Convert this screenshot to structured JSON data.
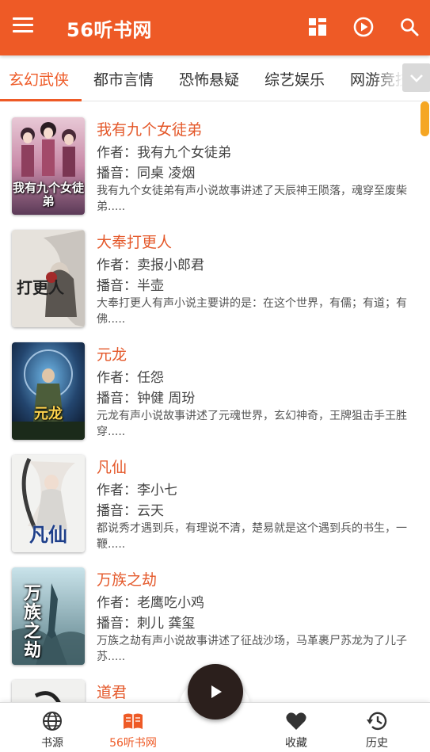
{
  "app": {
    "title": "56听书网"
  },
  "topbar": {
    "menu_icon": "menu-icon",
    "grid_icon": "grid-icon",
    "play_icon": "play-circle-icon",
    "search_icon": "search-icon"
  },
  "tabs": [
    {
      "label": "玄幻武侠",
      "active": true
    },
    {
      "label": "都市言情",
      "active": false
    },
    {
      "label": "恐怖悬疑",
      "active": false
    },
    {
      "label": "综艺娱乐",
      "active": false
    },
    {
      "label": "网游竞技",
      "active": false
    }
  ],
  "books": [
    {
      "title": "我有九个女徒弟",
      "author": "作者：我有九个女徒弟",
      "narrator": "播音：同桌 凌烟",
      "desc": "我有九个女徒弟有声小说故事讲述了天辰神王陨落，魂穿至废柴弟.....",
      "cover_text": "我有九个女徒弟"
    },
    {
      "title": "大奉打更人",
      "author": "作者：卖报小郎君",
      "narrator": "播音：半壶",
      "desc": "大奉打更人有声小说主要讲的是：在这个世界，有儒；有道；有佛.....",
      "cover_text": "打更人"
    },
    {
      "title": "元龙",
      "author": "作者：任怨",
      "narrator": "播音：钟健 周玢",
      "desc": "元龙有声小说故事讲述了元魂世界，玄幻神奇，王牌狙击手王胜穿.....",
      "cover_text": "元龙"
    },
    {
      "title": "凡仙",
      "author": "作者：李小七",
      "narrator": "播音：云天",
      "desc": "都说秀才遇到兵，有理说不清，楚易就是这个遇到兵的书生，一鞭.....",
      "cover_text": "凡仙"
    },
    {
      "title": "万族之劫",
      "author": "作者：老鹰吃小鸡",
      "narrator": "播音：刺儿 龚玺",
      "desc": "万族之劫有声小说故事讲述了征战沙场，马革裹尸苏龙为了儿子苏.....",
      "cover_text": "万族之劫"
    },
    {
      "title": "道君",
      "author": "",
      "narrator": "",
      "desc": "",
      "cover_text": ""
    }
  ],
  "bottom_nav": [
    {
      "label": "书源",
      "icon": "globe-icon",
      "active": false
    },
    {
      "label": "56听书网",
      "icon": "book-icon",
      "active": true
    },
    {
      "label": "收藏",
      "icon": "heart-icon",
      "active": false
    },
    {
      "label": "历史",
      "icon": "history-icon",
      "active": false
    }
  ],
  "player": {
    "icon": "play-icon"
  },
  "colors": {
    "accent": "#ee5a26",
    "title_text": "#e4582a",
    "scroll_thumb": "#f5a623",
    "fab": "#2b1f1c"
  }
}
